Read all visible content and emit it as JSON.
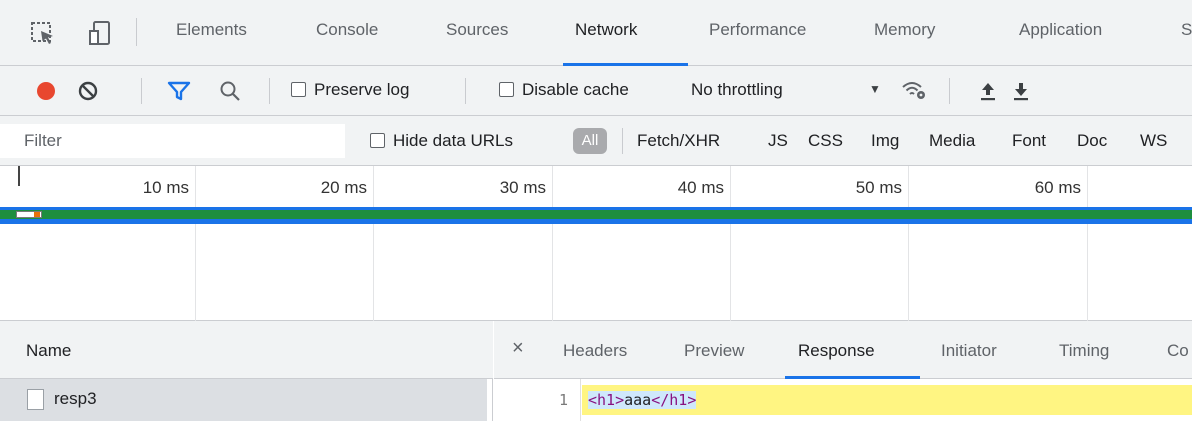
{
  "devtools": {
    "tabs": [
      "Elements",
      "Console",
      "Sources",
      "Network",
      "Performance",
      "Memory",
      "Application",
      "S"
    ],
    "active_tab": "Network"
  },
  "toolbar": {
    "preserve_log": "Preserve log",
    "disable_cache": "Disable cache",
    "throttling": "No throttling",
    "throttling_arrow": "▼"
  },
  "filter": {
    "placeholder": "Filter",
    "hide_data_urls": "Hide data URLs",
    "types": [
      "All",
      "Fetch/XHR",
      "JS",
      "CSS",
      "Img",
      "Media",
      "Font",
      "Doc",
      "WS"
    ],
    "active_type": "All"
  },
  "timeline": {
    "ticks": [
      "10 ms",
      "20 ms",
      "30 ms",
      "40 ms",
      "50 ms",
      "60 ms"
    ],
    "colors": {
      "receiving": "#1e8e3e",
      "waiting": "#1a73e8",
      "queueing": "#e8710a"
    }
  },
  "requests": {
    "header": "Name",
    "rows": [
      {
        "name": "resp3"
      }
    ]
  },
  "details": {
    "close": "×",
    "tabs": [
      "Headers",
      "Preview",
      "Response",
      "Initiator",
      "Timing",
      "Co"
    ],
    "active_tab": "Response"
  },
  "response": {
    "line_number": "1",
    "open_tag": "<h1>",
    "content": "aaa",
    "close_tag": "</h1>"
  },
  "icons": [
    "inspect-icon",
    "device-toolbar-icon",
    "record-icon",
    "clear-icon",
    "filter-icon",
    "search-icon",
    "network-conditions-icon",
    "import-har-icon",
    "export-har-icon"
  ]
}
